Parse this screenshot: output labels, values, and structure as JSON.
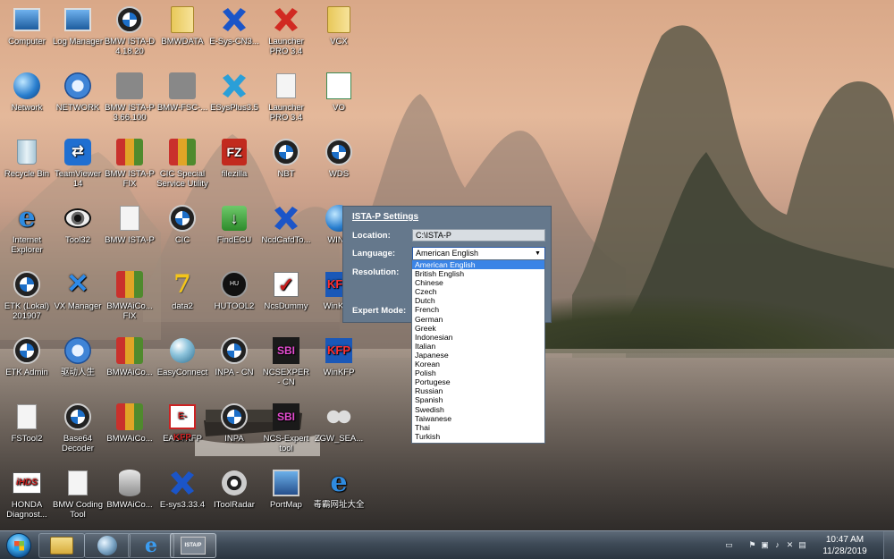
{
  "desktop": {
    "icons": [
      {
        "label": "Computer",
        "icon": "computer-icon"
      },
      {
        "label": "Log Manager",
        "icon": "log-manager-icon"
      },
      {
        "label": "BMW ISTA-D 4.18.20",
        "icon": "bmw-logo-icon"
      },
      {
        "label": "BMWDATA",
        "icon": "folder-icon"
      },
      {
        "label": "E-Sys-CN3...",
        "icon": "esys-icon"
      },
      {
        "label": "Launcher PRO 3.4",
        "icon": "esys-launcher-icon"
      },
      {
        "label": "VCX",
        "icon": "folder-icon"
      },
      {
        "label": "Network",
        "icon": "network-icon"
      },
      {
        "label": "NETWORK",
        "icon": "gear-icon"
      },
      {
        "label": "BMW ISTA-P 3.66.100",
        "icon": "ista-p-icon"
      },
      {
        "label": "BMW-FSC-...",
        "icon": "wrench-icon"
      },
      {
        "label": "ESysPlus3.5",
        "icon": "esys-plus-icon"
      },
      {
        "label": "Launcher PRO 3.4",
        "icon": "document-icon"
      },
      {
        "label": "VO",
        "icon": "vo-file-icon"
      },
      {
        "label": "Recycle Bin",
        "icon": "recycle-bin-icon"
      },
      {
        "label": "TeamViewer 14",
        "icon": "teamviewer-icon"
      },
      {
        "label": "BMW ISTA-P FIX",
        "icon": "winrar-icon"
      },
      {
        "label": "CIC Special Service Utility",
        "icon": "toolbox-icon"
      },
      {
        "label": "filezilla",
        "icon": "filezilla-icon"
      },
      {
        "label": "NBT",
        "icon": "bmw-logo-icon"
      },
      {
        "label": "WDS",
        "icon": "bmw-logo-icon"
      },
      {
        "label": "Internet Explorer",
        "icon": "internet-explorer-icon"
      },
      {
        "label": "Tool32",
        "icon": "eye-icon"
      },
      {
        "label": "BMW ISTA-P",
        "icon": "document-icon"
      },
      {
        "label": "CIC",
        "icon": "bmw-logo-icon"
      },
      {
        "label": "FindECU",
        "icon": "download-icon"
      },
      {
        "label": "NcdCafdTo...",
        "icon": "esys-icon"
      },
      {
        "label": "WIND",
        "icon": "globe-icon"
      },
      {
        "label": "ETK (Lokal) 201907",
        "icon": "bmw-etk-icon"
      },
      {
        "label": "VX Manager",
        "icon": "vx-manager-icon"
      },
      {
        "label": "BMWAiCo... FIX",
        "icon": "winrar-icon"
      },
      {
        "label": "data2",
        "icon": "seven-zip-icon"
      },
      {
        "label": "HUTOOL2",
        "icon": "hutool-icon"
      },
      {
        "label": "NcsDummy",
        "icon": "checkmark-icon"
      },
      {
        "label": "WinKFP",
        "icon": "kfp-icon"
      },
      {
        "label": "ETK Admin",
        "icon": "bmw-etk-icon"
      },
      {
        "label": "驱动人生",
        "icon": "gear-icon"
      },
      {
        "label": "BMWAiCo...",
        "icon": "aico-icon"
      },
      {
        "label": "EasyConnect",
        "icon": "easyconnect-icon"
      },
      {
        "label": "INPA - CN",
        "icon": "inpa-icon"
      },
      {
        "label": "NCSEXPER - CN",
        "icon": "ncsexpert-icon"
      },
      {
        "label": "WinKFP",
        "icon": "kfp-icon"
      },
      {
        "label": "FSTool2",
        "icon": "fstool-icon"
      },
      {
        "label": "Base64 Decoder",
        "icon": "bmw-logo-icon"
      },
      {
        "label": "BMWAiCo...",
        "icon": "aico-icon"
      },
      {
        "label": "EASYKFP",
        "icon": "ekfp-icon"
      },
      {
        "label": "INPA",
        "icon": "inpa-icon"
      },
      {
        "label": "NCS-Expert tool",
        "icon": "ncsexpert-icon"
      },
      {
        "label": "ZGW_SEA...",
        "icon": "binoculars-icon"
      },
      {
        "label": "HONDA Diagnost...",
        "icon": "hds-icon"
      },
      {
        "label": "BMW Coding Tool",
        "icon": "coding-tool-icon"
      },
      {
        "label": "BMWAiCo...",
        "icon": "database-icon"
      },
      {
        "label": "E-sys3.33.4",
        "icon": "esys-icon"
      },
      {
        "label": "IToolRadar",
        "icon": "radar-icon"
      },
      {
        "label": "PortMap",
        "icon": "network-map-icon"
      },
      {
        "label": "毒霸网址大全",
        "icon": "internet-explorer-icon"
      }
    ]
  },
  "dialog": {
    "title": "ISTA-P Settings",
    "location_label": "Location:",
    "location_value": "C:\\ISTA-P",
    "language_label": "Language:",
    "language_value": "American English",
    "resolution_label": "Resolution:",
    "expert_mode_label": "Expert Mode:",
    "language_options": [
      "American English",
      "British English",
      "Chinese",
      "Czech",
      "Dutch",
      "French",
      "German",
      "Greek",
      "Indonesian",
      "Italian",
      "Japanese",
      "Korean",
      "Polish",
      "Portugese",
      "Russian",
      "Spanish",
      "Swedish",
      "Taiwanese",
      "Thai",
      "Turkish"
    ]
  },
  "taskbar": {
    "pinned": [
      "windows-explorer-icon",
      "network-globe-icon",
      "internet-explorer-icon",
      "ista-p-icon"
    ],
    "clock_time": "10:47 AM",
    "clock_date": "11/28/2019",
    "ista_badge": "ISTA/P"
  },
  "colors": {
    "dialog_bg": "#65788c",
    "selection": "#3a84e6"
  }
}
